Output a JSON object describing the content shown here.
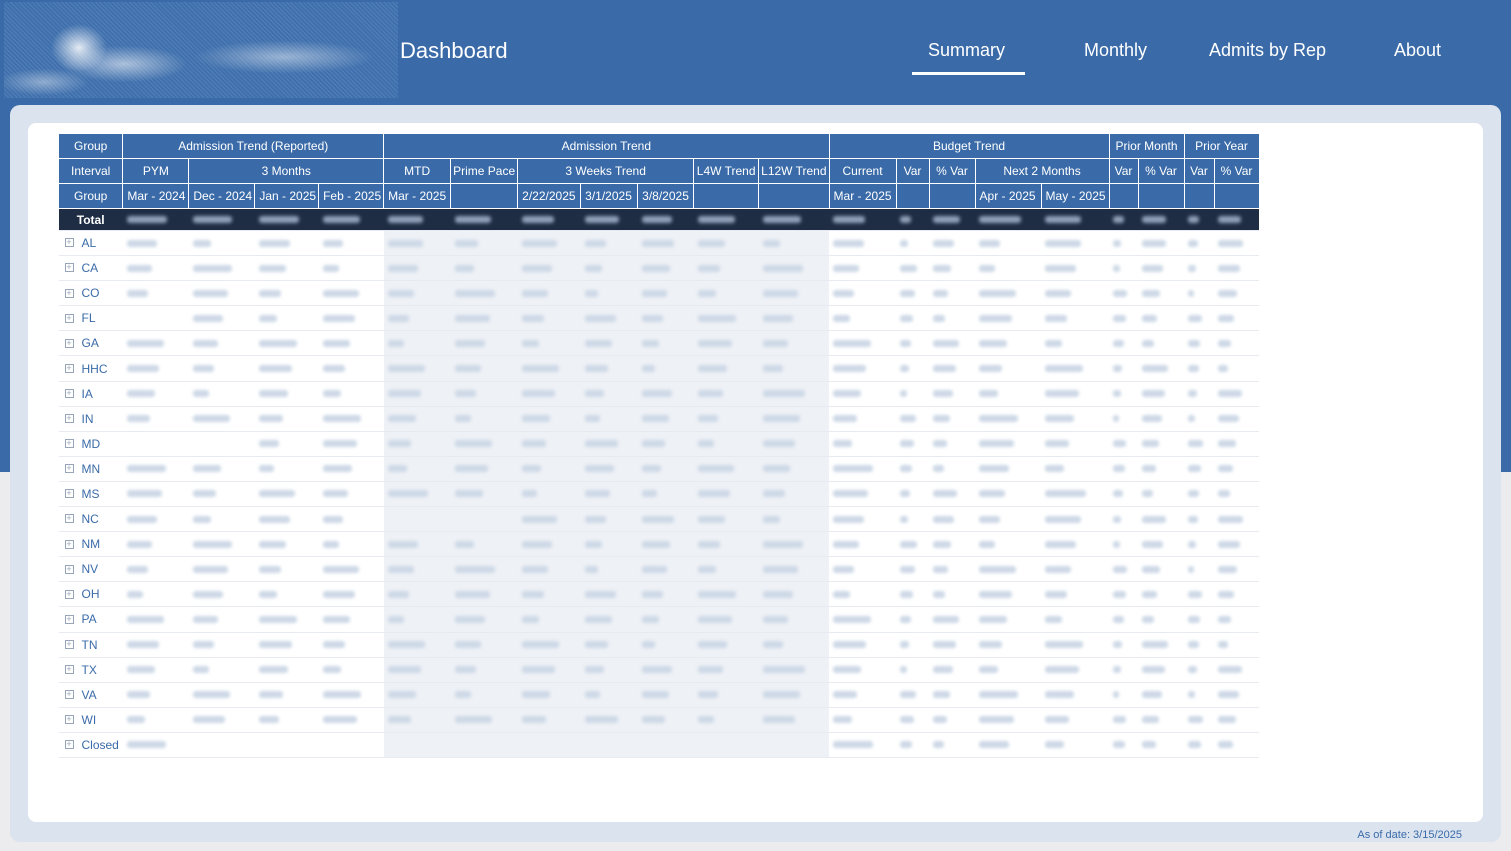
{
  "header": {
    "title": "Dashboard",
    "nav": [
      {
        "label": "Summary",
        "active": true
      },
      {
        "label": "Monthly",
        "active": false
      },
      {
        "label": "Admits by Rep",
        "active": false
      },
      {
        "label": "About",
        "active": false
      }
    ]
  },
  "table": {
    "header_row1": {
      "group": "Group",
      "admission_trend_reported": "Admission Trend (Reported)",
      "admission_trend": "Admission Trend",
      "budget_trend": "Budget Trend",
      "prior_month": "Prior Month",
      "prior_year": "Prior Year"
    },
    "header_row2": {
      "interval": "Interval",
      "pym": "PYM",
      "three_months": "3 Months",
      "mtd": "MTD",
      "prime_pace": "Prime Pace",
      "three_weeks_trend": "3 Weeks Trend",
      "l4w_trend": "L4W Trend",
      "l12w_trend": "L12W Trend",
      "current": "Current",
      "var": "Var",
      "pct_var": "% Var",
      "next_2_months": "Next 2 Months",
      "pm_var": "Var",
      "pm_pct_var": "% Var",
      "py_var": "Var",
      "py_pct_var": "% Var"
    },
    "header_row3": {
      "group": "Group",
      "pym_month": "Mar - 2024",
      "m1": "Dec - 2024",
      "m2": "Jan - 2025",
      "m3": "Feb - 2025",
      "mtd_month": "Mar - 2025",
      "w1": "2/22/2025",
      "w2": "3/1/2025",
      "w3": "3/8/2025",
      "current_month": "Mar - 2025",
      "next1": "Apr - 2025",
      "next2": "May - 2025"
    },
    "total_label": "Total",
    "rows": [
      "AL",
      "CA",
      "CO",
      "FL",
      "GA",
      "HHC",
      "IA",
      "IN",
      "MD",
      "MN",
      "MS",
      "NC",
      "NM",
      "NV",
      "OH",
      "PA",
      "TN",
      "TX",
      "VA",
      "WI",
      "Closed"
    ]
  },
  "footer": {
    "as_of": "As of date: 3/15/2025"
  },
  "colors": {
    "brand_blue": "#3a6ba8",
    "total_row": "#1f2d44",
    "frame": "#dbe3ef"
  },
  "icons": {
    "expand": "plus-box-icon",
    "logo": "speckled-logo"
  }
}
